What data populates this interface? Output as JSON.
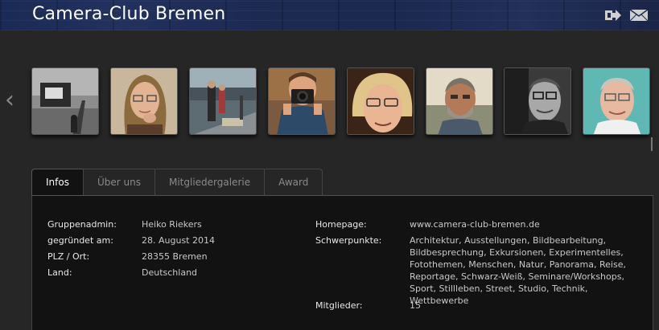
{
  "header": {
    "title": "Camera-Club Bremen",
    "icons": [
      "share-icon",
      "mail-icon"
    ]
  },
  "carousel": {
    "prev_icon": "‹",
    "members": [
      {
        "alt": "member-photo-1"
      },
      {
        "alt": "member-photo-2"
      },
      {
        "alt": "member-photo-3"
      },
      {
        "alt": "member-photo-4"
      },
      {
        "alt": "member-photo-5"
      },
      {
        "alt": "member-photo-6"
      },
      {
        "alt": "member-photo-7"
      },
      {
        "alt": "member-photo-8"
      }
    ]
  },
  "tabs": [
    "Infos",
    "Über uns",
    "Mitgliedergalerie",
    "Award"
  ],
  "info": {
    "left": [
      {
        "label": "Gruppenadmin:",
        "value": "Heiko Riekers"
      },
      {
        "label": "gegründet am:",
        "value": "28. August 2014"
      },
      {
        "label": "PLZ / Ort:",
        "value": "28355 Bremen"
      },
      {
        "label": "Land:",
        "value": "Deutschland"
      }
    ],
    "homepage_label": "Homepage:",
    "homepage_value": "www.camera-club-bremen.de",
    "focus_label": "Schwerpunkte:",
    "focus_value": "Architektur, Ausstellungen, Bildbearbeitung, Bildbesprechung, Exkursionen, Experimentelles, Fotothemen, Menschen, Natur, Panorama, Reise, Reportage, Schwarz-Weiß, Seminare/Workshops, Sport, Stillleben, Street, Studio, Technik, Wettbewerbe",
    "members_label": "Mitglieder:",
    "members_value": "15"
  },
  "colors": {
    "background": "#262626",
    "panel": "#121212",
    "header": "#1c2a52"
  }
}
